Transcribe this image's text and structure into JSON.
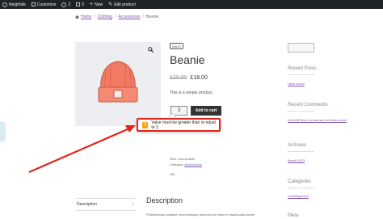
{
  "admin_bar": {
    "site_name": "Neighbile",
    "customize": "Customize",
    "updates_count": "2",
    "comments_count": "0",
    "new_label": "New",
    "edit_label": "Edit product"
  },
  "breadcrumb": {
    "home": "Home",
    "clothing": "Clothing",
    "accessories": "Accessories",
    "current": "Beanie"
  },
  "product": {
    "sale_badge": "SALE!",
    "title": "Beanie",
    "old_price": "£20.00",
    "new_price": "£18.00",
    "short_description": "This is a simple product.",
    "quantity": "3",
    "add_to_cart": "Add to cart",
    "colors": {
      "accent": "#7f54b3",
      "button": "#333333",
      "beanie": "#f27a62"
    }
  },
  "validation": {
    "message": "Value must be greater than or equal to 2.",
    "icon": "warning-icon",
    "border_color": "#e1251b"
  },
  "meta": {
    "sku_label": "SKU: woo-beanie",
    "category_prefix": "Category:",
    "category_link": "Accessories",
    "gift_label": "Gift"
  },
  "tabs": {
    "description_tab": "Description",
    "description_heading": "Description",
    "description_text": "Pellentesque habitant morbi tristique senectus et netus et malesuada fames"
  },
  "sidebar": {
    "recent_posts_heading": "Recent Posts",
    "recent_post_1": "Hello world!",
    "recent_comments_heading": "Recent Comments",
    "comment_author": "A WordPress Commenter",
    "comment_on": "on",
    "comment_post": "Hello world!",
    "archives_heading": "Archives",
    "archive_1": "March 2023",
    "categories_heading": "Categories",
    "category_1": "Uncategorized",
    "meta_heading": "Meta"
  },
  "annotation": {
    "arrow_color": "#e1251b"
  }
}
